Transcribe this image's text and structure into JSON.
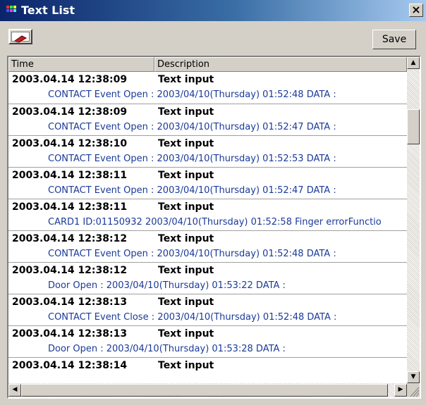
{
  "window": {
    "title": "Text List",
    "close_label": "×"
  },
  "toolbar": {
    "save_label": "Save"
  },
  "columns": [
    "Time",
    "Description"
  ],
  "rows": [
    {
      "time": "2003.04.14 12:38:09",
      "type": "Text input",
      "desc": "CONTACT Event Open : 2003/04/10(Thursday) 01:52:48 DATA :"
    },
    {
      "time": "2003.04.14 12:38:09",
      "type": "Text input",
      "desc": "CONTACT Event Open : 2003/04/10(Thursday) 01:52:47 DATA :"
    },
    {
      "time": "2003.04.14 12:38:10",
      "type": "Text input",
      "desc": "CONTACT Event Open : 2003/04/10(Thursday) 01:52:53 DATA :"
    },
    {
      "time": "2003.04.14 12:38:11",
      "type": "Text input",
      "desc": "CONTACT Event Open : 2003/04/10(Thursday) 01:52:47 DATA :"
    },
    {
      "time": "2003.04.14 12:38:11",
      "type": "Text input",
      "desc": "CARD1 ID:01150932 2003/04/10(Thursday) 01:52:58 Finger errorFunctio"
    },
    {
      "time": "2003.04.14 12:38:12",
      "type": "Text input",
      "desc": "CONTACT Event Open : 2003/04/10(Thursday) 01:52:48 DATA :"
    },
    {
      "time": "2003.04.14 12:38:12",
      "type": "Text input",
      "desc": "Door Open : 2003/04/10(Thursday) 01:53:22 DATA :"
    },
    {
      "time": "2003.04.14 12:38:13",
      "type": "Text input",
      "desc": "CONTACT Event Close : 2003/04/10(Thursday) 01:52:48 DATA :"
    },
    {
      "time": "2003.04.14 12:38:13",
      "type": "Text input",
      "desc": "Door Open : 2003/04/10(Thursday) 01:53:28 DATA :"
    },
    {
      "time": "2003.04.14 12:38:14",
      "type": "Text input",
      "desc": ""
    }
  ],
  "icons": {
    "app": "app-icon",
    "toolbar": "eraser-icon"
  },
  "colors": {
    "title_start": "#0a246a",
    "title_end": "#a6caf0",
    "desc_text": "#1a3a9a"
  }
}
